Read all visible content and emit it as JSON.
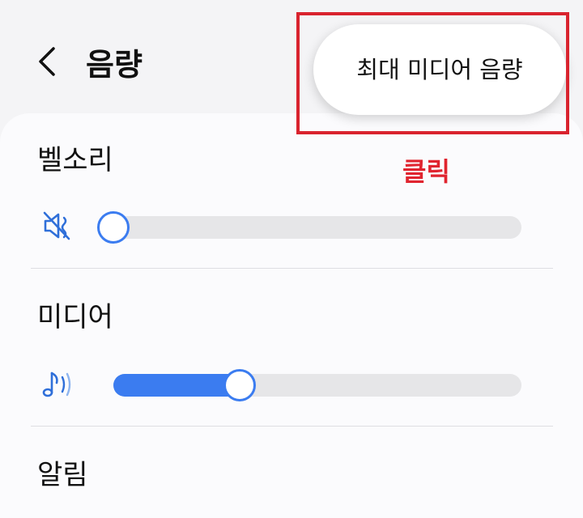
{
  "header": {
    "title": "음량"
  },
  "menu": {
    "popup_item": "최대 미디어 음량"
  },
  "annotation": {
    "click_label": "클릭",
    "color": "#e0242f"
  },
  "sections": {
    "ringtone": {
      "label": "벨소리",
      "icon": "mute-speaker-icon",
      "level": 0
    },
    "media": {
      "label": "미디어",
      "icon": "music-note-icon",
      "level": 0.33
    },
    "notifications": {
      "label": "알림"
    }
  },
  "colors": {
    "accent": "#3b7cf0",
    "track": "#e6e6e8",
    "highlight_border": "#d9232e"
  }
}
